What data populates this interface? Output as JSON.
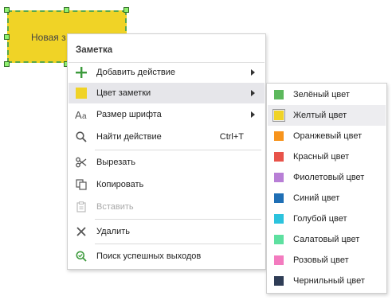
{
  "note": {
    "text": "Новая з"
  },
  "menu": {
    "title": "Заметка",
    "items": [
      {
        "label": "Добавить действие",
        "icon": "plus-icon"
      },
      {
        "label": "Цвет заметки",
        "icon": "color-swatch-icon"
      },
      {
        "label": "Размер шрифта",
        "icon": "font-size-icon"
      },
      {
        "label": "Найти действие",
        "icon": "search-icon",
        "shortcut": "Ctrl+T"
      },
      {
        "label": "Вырезать",
        "icon": "scissors-icon"
      },
      {
        "label": "Копировать",
        "icon": "copy-icon"
      },
      {
        "label": "Вставить",
        "icon": "paste-icon",
        "disabled": true
      },
      {
        "label": "Удалить",
        "icon": "close-icon"
      },
      {
        "label": "Поиск успешных выходов",
        "icon": "search-success-icon"
      }
    ]
  },
  "submenu": {
    "items": [
      {
        "label": "Зелёный цвет",
        "color": "#5cb85c"
      },
      {
        "label": "Желтый цвет",
        "color": "#f0d326",
        "checked": true
      },
      {
        "label": "Оранжевый цвет",
        "color": "#f7941d"
      },
      {
        "label": "Красный цвет",
        "color": "#e8534a"
      },
      {
        "label": "Фиолетовый цвет",
        "color": "#b87fd6"
      },
      {
        "label": "Синий цвет",
        "color": "#1f6fb5"
      },
      {
        "label": "Голубой цвет",
        "color": "#2cc3dd"
      },
      {
        "label": "Салатовый цвет",
        "color": "#5ee0a0"
      },
      {
        "label": "Розовый цвет",
        "color": "#f37bbf"
      },
      {
        "label": "Чернильный цвет",
        "color": "#2f3d56"
      }
    ]
  }
}
